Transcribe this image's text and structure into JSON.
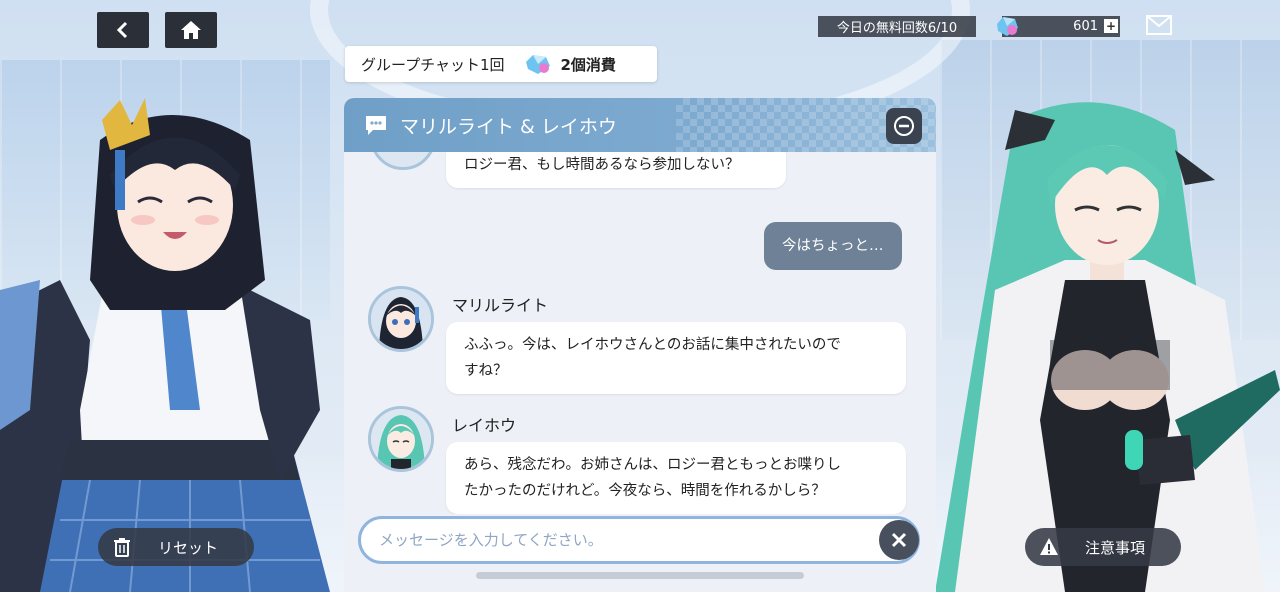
{
  "top_bar": {
    "back_icon": "chevron-left-icon",
    "home_icon": "home-icon",
    "free_count_text": "今日の無料回数6/10",
    "gem_count": "601",
    "plus_label": "+",
    "mail_icon": "mail-icon"
  },
  "cost": {
    "label": "グループチャット1回",
    "amount": "2個消費"
  },
  "chat": {
    "title": "マリルライト & レイホウ",
    "messages": [
      {
        "type": "received-partial",
        "text": "ロジー君、もし時間あるなら参加しない？"
      },
      {
        "type": "sent",
        "text": "今はちょっと…"
      },
      {
        "type": "received",
        "sender": "マリルライト",
        "text_line1": "ふふっ。今は、レイホウさんとのお話に集中されたいので",
        "text_line2": "すね？"
      },
      {
        "type": "received",
        "sender": "レイホウ",
        "text_line1": "あら、残念だわ。お姉さんは、ロジー君ともっとお喋りし",
        "text_line2": "たかったのだけれど。今夜なら、時間を作れるかしら？"
      }
    ],
    "input_placeholder": "メッセージを入力してください。",
    "input_value": ""
  },
  "buttons": {
    "reset_label": "リセット",
    "notice_label": "注意事項"
  },
  "colors": {
    "header_blue": "#7eaad0",
    "dark_button": "#343a46",
    "sent_bubble": "#6e8197",
    "input_border": "#8fb4dd"
  }
}
